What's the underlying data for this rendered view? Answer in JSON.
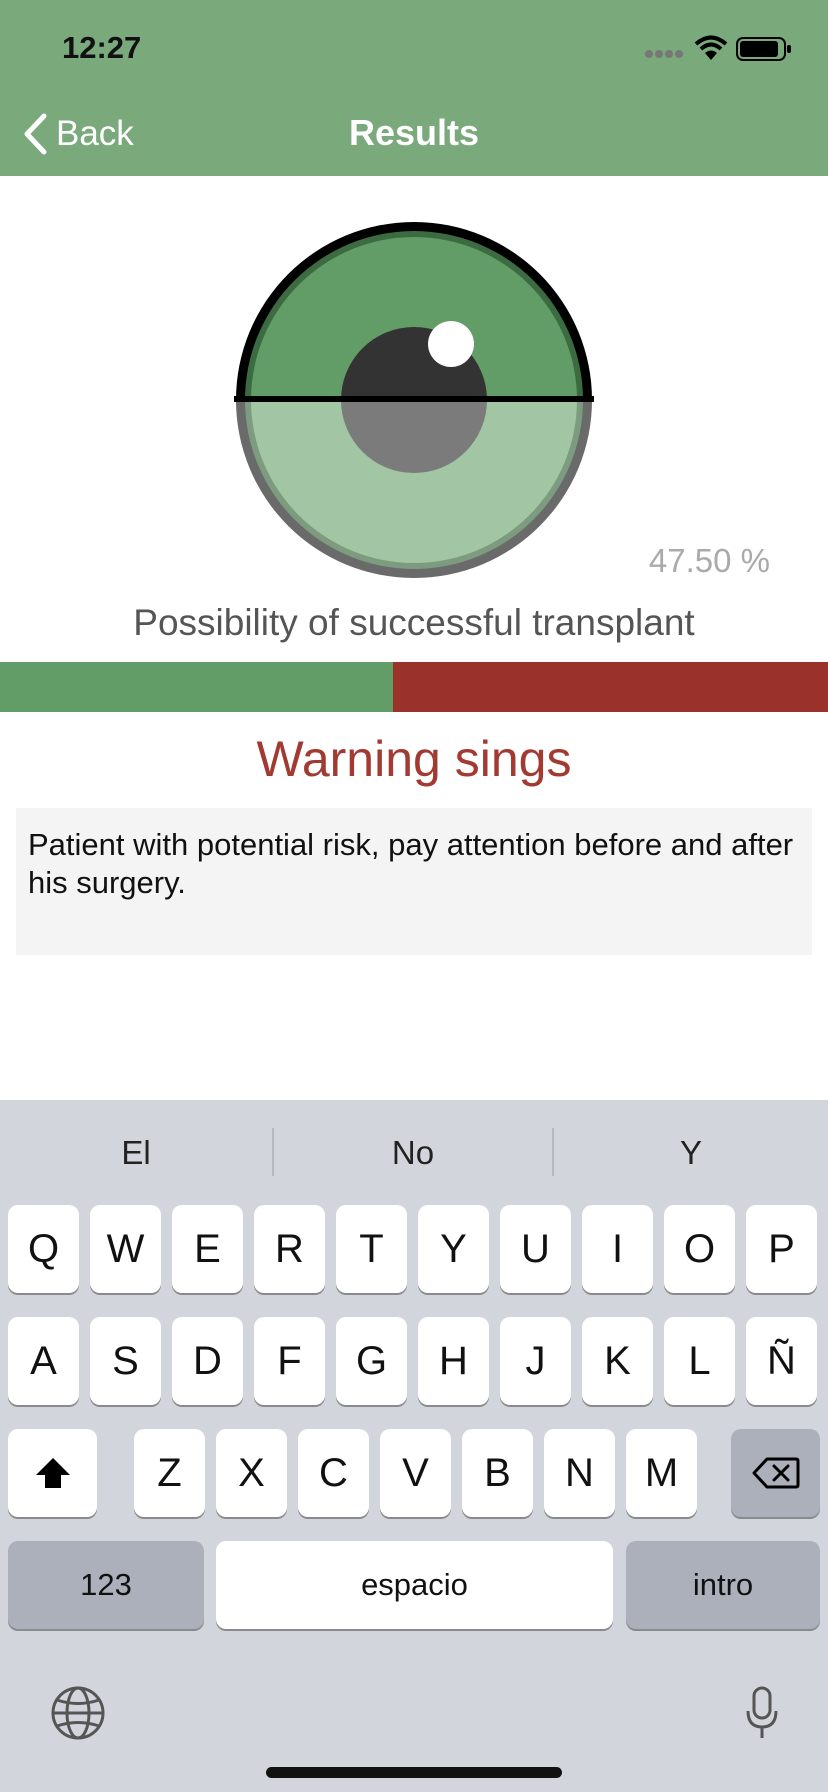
{
  "status_bar": {
    "time": "12:27"
  },
  "nav": {
    "back_label": "Back",
    "title": "Results"
  },
  "result": {
    "percent_text": "47.50 %",
    "probability": 0.475,
    "caption": "Possibility of successful transplant",
    "colors": {
      "good": "#629c66",
      "bad": "#9a312a",
      "eye_top": "#629c66",
      "eye_bottom": "#a2c6a3"
    }
  },
  "warning": {
    "title": "Warning sings",
    "message": "Patient with potential risk, pay attention before and after his surgery."
  },
  "keyboard": {
    "suggestions": [
      "El",
      "No",
      "Y"
    ],
    "row1": [
      "Q",
      "W",
      "E",
      "R",
      "T",
      "Y",
      "U",
      "I",
      "O",
      "P"
    ],
    "row2": [
      "A",
      "S",
      "D",
      "F",
      "G",
      "H",
      "J",
      "K",
      "L",
      "Ñ"
    ],
    "row3": [
      "Z",
      "X",
      "C",
      "V",
      "B",
      "N",
      "M"
    ],
    "numbers_label": "123",
    "space_label": "espacio",
    "return_label": "intro",
    "icons": {
      "shift": "shift-icon",
      "delete": "backspace-icon",
      "globe": "globe-icon",
      "mic": "microphone-icon"
    }
  }
}
